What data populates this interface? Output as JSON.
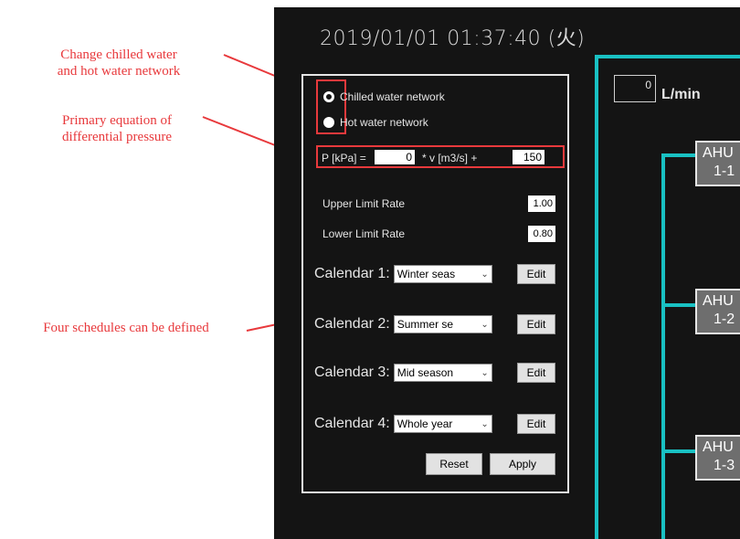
{
  "annotations": {
    "change_network": [
      "Change chilled water",
      "and hot water network"
    ],
    "primary_equation": [
      "Primary equation of",
      "differential pressure"
    ],
    "schedules": "Four schedules can be defined"
  },
  "screen": {
    "datetime": "2019/01/01 01:37:40 (火)",
    "network": {
      "chilled_label": "Chilled water network",
      "hot_label": "Hot water network",
      "selected": "chilled"
    },
    "equation": {
      "prefix": "P [kPa] =",
      "coef": "0",
      "middle": "* v [m3/s] +",
      "const": "150"
    },
    "limits": {
      "upper_label": "Upper Limit Rate",
      "upper_value": "1.00",
      "lower_label": "Lower Limit Rate",
      "lower_value": "0.80"
    },
    "calendars": [
      {
        "label": "Calendar 1:",
        "selected": "Winter seas",
        "button": "Edit"
      },
      {
        "label": "Calendar 2:",
        "selected": "Summer se",
        "button": "Edit"
      },
      {
        "label": "Calendar 3:",
        "selected": "Mid season",
        "button": "Edit"
      },
      {
        "label": "Calendar 4:",
        "selected": "Whole year",
        "button": "Edit"
      }
    ],
    "reset_label": "Reset",
    "apply_label": "Apply",
    "flow": {
      "value": "0",
      "unit": "L/min"
    },
    "ahus": [
      {
        "line1": "AHU",
        "line2": "1-1"
      },
      {
        "line1": "AHU",
        "line2": "1-2"
      },
      {
        "line1": "AHU",
        "line2": "1-3"
      }
    ]
  },
  "colors": {
    "annotation": "#e8393c",
    "pipe": "#19c1c3",
    "screen_bg": "#141414"
  }
}
